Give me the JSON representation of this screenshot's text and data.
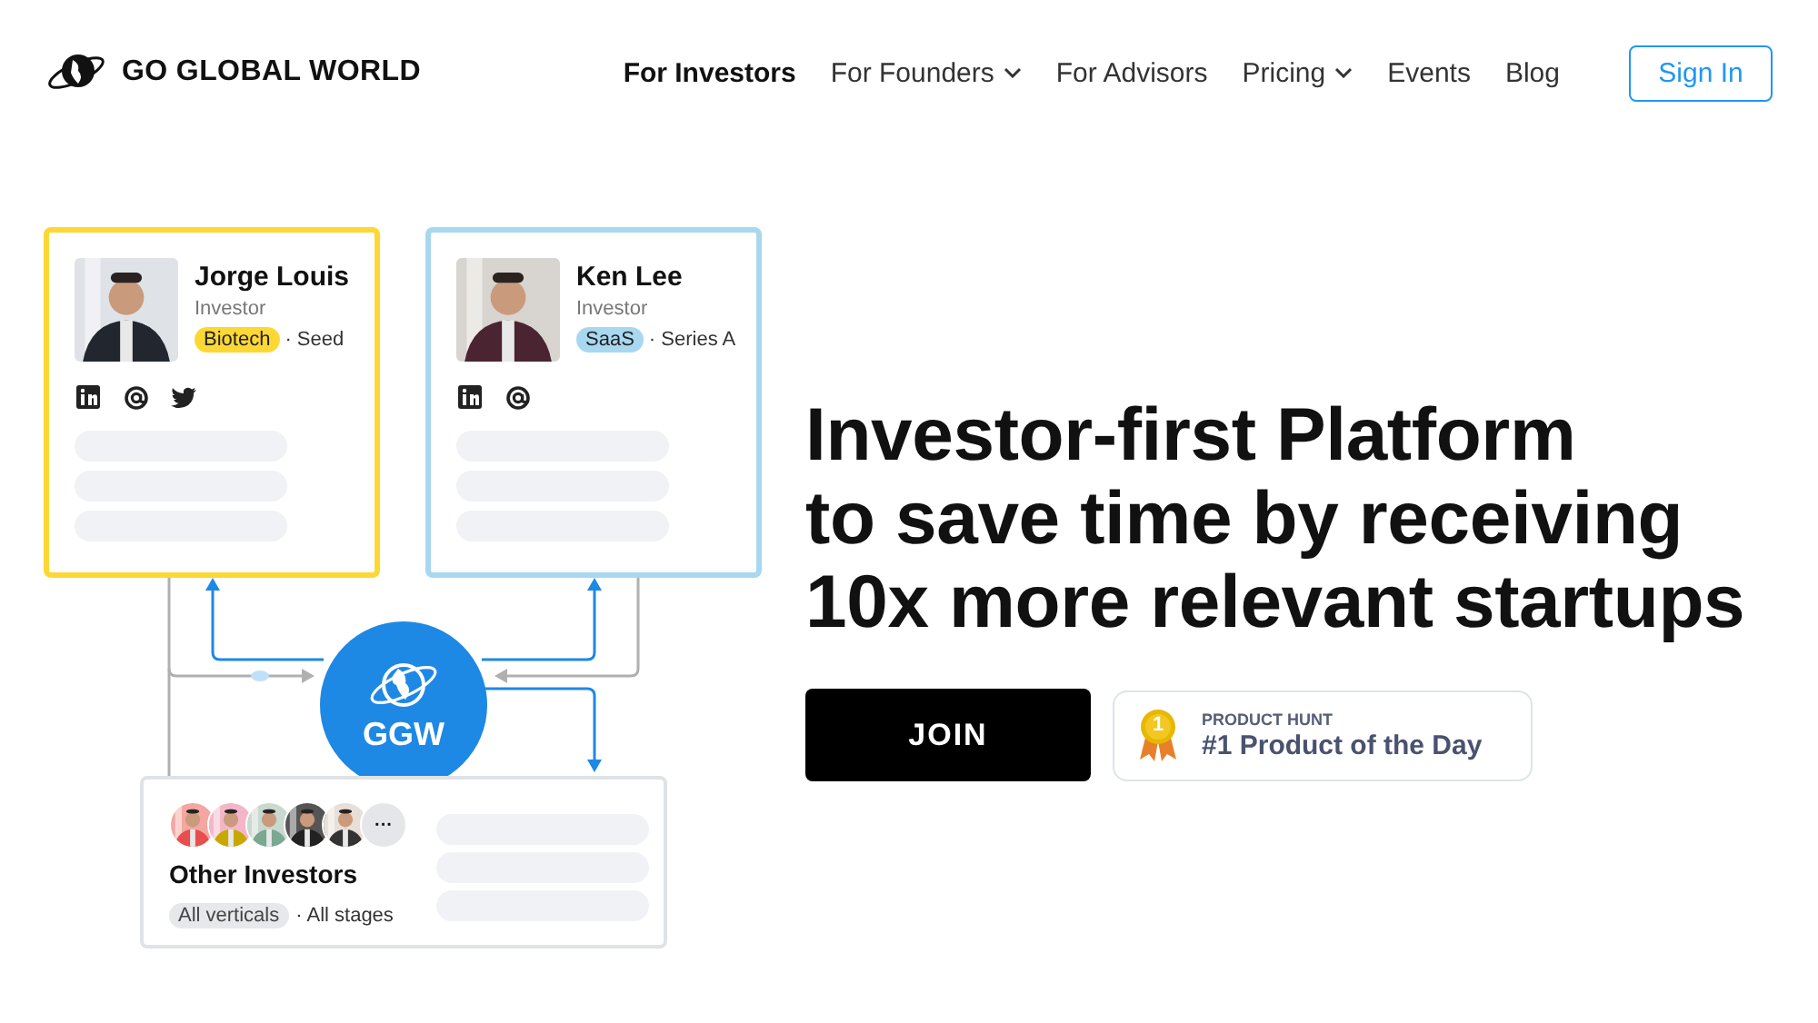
{
  "header": {
    "brand": "GO GLOBAL WORLD",
    "nav": [
      {
        "label": "For Investors",
        "selected": true,
        "dropdown": false
      },
      {
        "label": "For Founders",
        "selected": false,
        "dropdown": true
      },
      {
        "label": "For Advisors",
        "selected": false,
        "dropdown": false
      },
      {
        "label": "Pricing",
        "selected": false,
        "dropdown": true
      },
      {
        "label": "Events",
        "selected": false,
        "dropdown": false
      },
      {
        "label": "Blog",
        "selected": false,
        "dropdown": false
      }
    ],
    "sign_in": "Sign In"
  },
  "diagram": {
    "investors": [
      {
        "name": "Jorge Louis",
        "role": "Investor",
        "tag": "Biotech",
        "stage": "· Seed",
        "color": "#fdd835",
        "socials": [
          {
            "kind": "linkedin"
          },
          {
            "kind": "email"
          },
          {
            "kind": "twitter"
          }
        ]
      },
      {
        "name": "Ken Lee",
        "role": "Investor",
        "tag": "SaaS",
        "stage": "· Series A",
        "color": "#a8d8f0",
        "socials": [
          {
            "kind": "linkedin"
          },
          {
            "kind": "email"
          }
        ]
      }
    ],
    "hub": "GGW",
    "others": {
      "more": "···",
      "title": "Other Investors",
      "tag": "All verticals",
      "stage": "· All stages"
    }
  },
  "hero": {
    "headline": [
      "Investor-first Platform",
      "to save time by receiving",
      "10x more relevant startups"
    ],
    "join": "JOIN",
    "badge": {
      "medal": "1",
      "label": "PRODUCT HUNT",
      "title": "#1 Product of the Day"
    }
  }
}
